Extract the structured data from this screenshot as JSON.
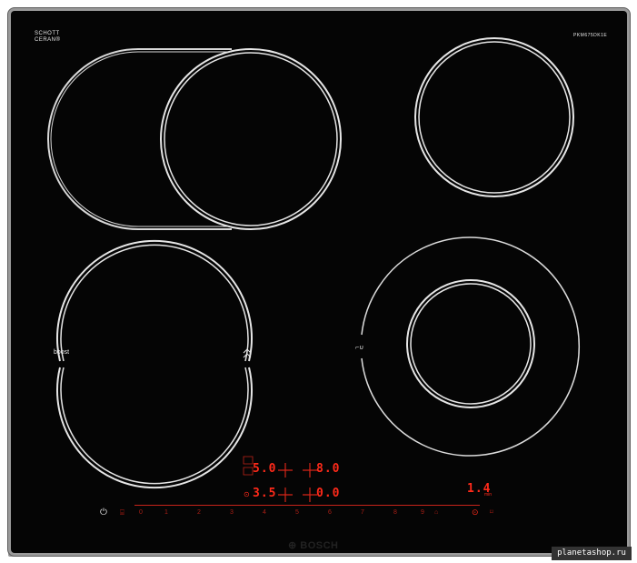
{
  "brand": {
    "schott_line1": "SCHOTT",
    "schott_line2": "CERAN®",
    "schott_sub": "SCHOTT CERAN",
    "model": "PKM675DK1E",
    "manufacturer": "BOSCH"
  },
  "zones": {
    "rear_left_label": "",
    "front_left_label": "boost",
    "front_right_label": "⌐∪"
  },
  "display": {
    "rear_left_value": "5.0",
    "rear_right_value": "8.0",
    "front_left_value": "3.5",
    "front_right_value": "0.0",
    "timer_value": "1.4",
    "timer_unit": "min"
  },
  "control_panel": {
    "power_symbol": "⏻",
    "slider_numbers": [
      "0",
      "1",
      "2",
      "3",
      "4",
      "5",
      "6",
      "7",
      "8",
      "9"
    ],
    "slider_labels": [
      "0",
      "1",
      ".",
      "2",
      ".",
      "3",
      ".",
      "4",
      ".",
      "5",
      ".",
      "6",
      ".",
      "7",
      ".",
      "8",
      ".",
      "9"
    ]
  },
  "watermark": "planetashop.ru",
  "colors": {
    "glass": "#050505",
    "zone_outline": "#e0e0e0",
    "display_red": "#ff2a1a"
  }
}
